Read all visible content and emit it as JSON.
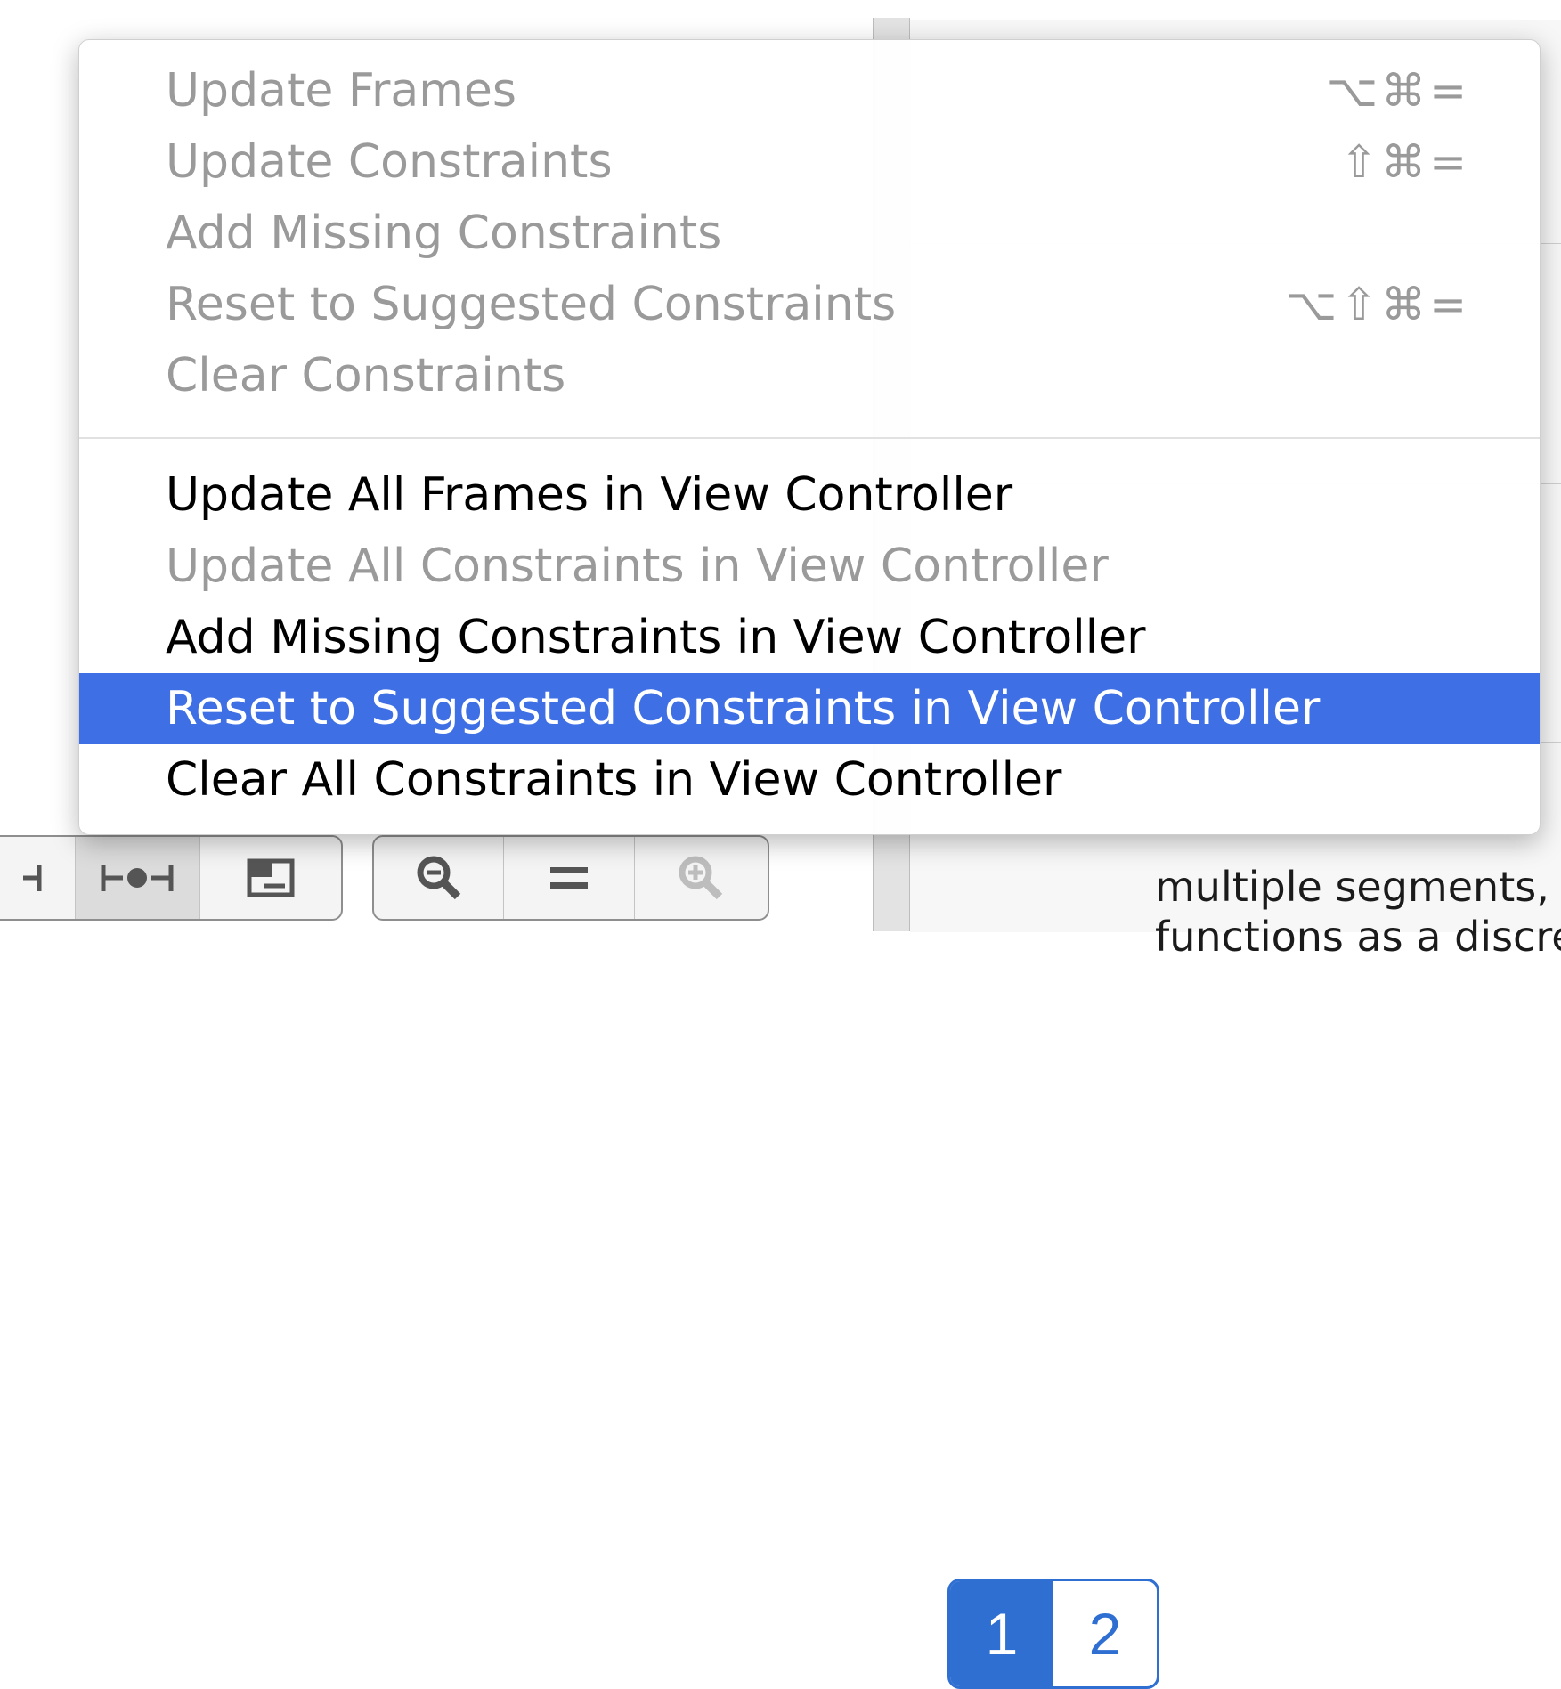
{
  "menu": {
    "items": [
      {
        "label": "Update Frames",
        "shortcut": "⌥⌘=",
        "enabled": false
      },
      {
        "label": "Update Constraints",
        "shortcut": "⇧⌘=",
        "enabled": false
      },
      {
        "label": "Add Missing Constraints",
        "shortcut": "",
        "enabled": false
      },
      {
        "label": "Reset to Suggested Constraints",
        "shortcut": "⌥⇧⌘=",
        "enabled": false
      },
      {
        "label": "Clear Constraints",
        "shortcut": "",
        "enabled": false
      },
      {
        "label": "Update All Frames in View Controller",
        "enabled": true
      },
      {
        "label": "Update All Constraints in View Controller",
        "enabled": false
      },
      {
        "label": "Add Missing Constraints in View Controller",
        "enabled": true
      },
      {
        "label": "Reset to Suggested Constraints in View Controller",
        "enabled": true,
        "selected": true
      },
      {
        "label": "Clear All Constraints in View Controller",
        "enabled": true
      }
    ],
    "selection_color": "#3e6fe5"
  },
  "library": {
    "segmented_entry": {
      "segments": [
        "1",
        "2"
      ],
      "description_lines": [
        "multiple segments, e",
        "functions as a discret"
      ]
    }
  },
  "toolbar": {
    "icons": [
      "pin-icon",
      "resolve-issues-icon",
      "resizing-icon",
      "zoom-out-icon",
      "zoom-reset-icon",
      "zoom-in-icon"
    ]
  }
}
